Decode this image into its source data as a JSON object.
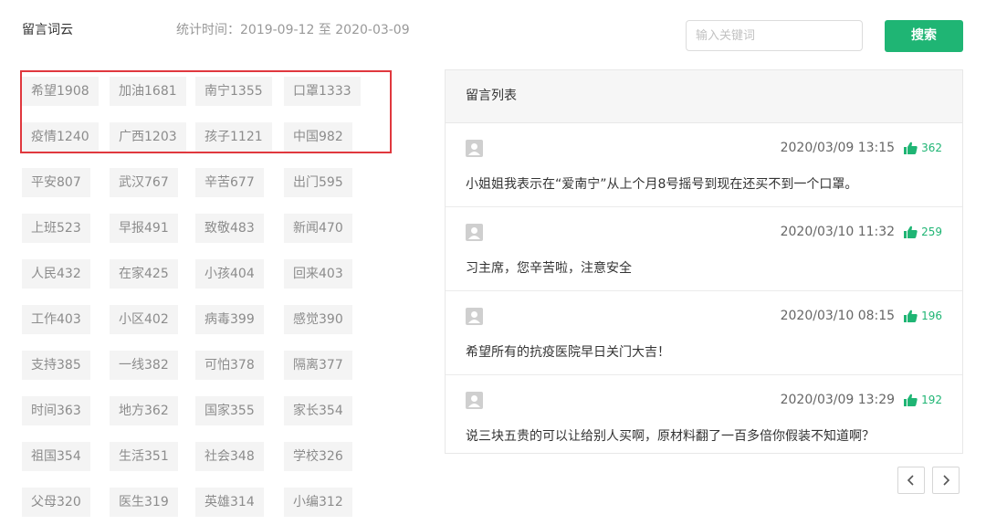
{
  "header": {
    "title": "留言词云",
    "stat_text": "统计时间：2019-09-12 至 2020-03-09",
    "search_placeholder": "输入关键词",
    "search_button": "搜索"
  },
  "tags": [
    "希望1908",
    "加油1681",
    "南宁1355",
    "口罩1333",
    "疫情1240",
    "广西1203",
    "孩子1121",
    "中国982",
    "平安807",
    "武汉767",
    "辛苦677",
    "出门595",
    "上班523",
    "早报491",
    "致敬483",
    "新闻470",
    "人民432",
    "在家425",
    "小孩404",
    "回来403",
    "工作403",
    "小区402",
    "病毒399",
    "感觉390",
    "支持385",
    "一线382",
    "可怕378",
    "隔离377",
    "时间363",
    "地方362",
    "国家355",
    "家长354",
    "祖国354",
    "生活351",
    "社会348",
    "学校326",
    "父母320",
    "医生319",
    "英雄314",
    "小编312"
  ],
  "panel": {
    "title": "留言列表",
    "messages": [
      {
        "time": "2020/03/09 13:15",
        "likes": "362",
        "text": "小姐姐我表示在“爱南宁”从上个月8号摇号到现在还买不到一个口罩。"
      },
      {
        "time": "2020/03/10 11:32",
        "likes": "259",
        "text": "习主席，您辛苦啦，注意安全"
      },
      {
        "time": "2020/03/10 08:15",
        "likes": "196",
        "text": "希望所有的抗疫医院早日关门大吉！"
      },
      {
        "time": "2020/03/09 13:29",
        "likes": "192",
        "text": "说三块五贵的可以让给别人买啊，原材料翻了一百多倍你假装不知道啊？"
      }
    ]
  },
  "colors": {
    "accent": "#1fb574",
    "highlight": "#e0383e"
  },
  "icons": {
    "avatar": "user-avatar-icon",
    "like": "thumbs-up-icon",
    "prev": "chevron-left-icon",
    "next": "chevron-right-icon"
  }
}
